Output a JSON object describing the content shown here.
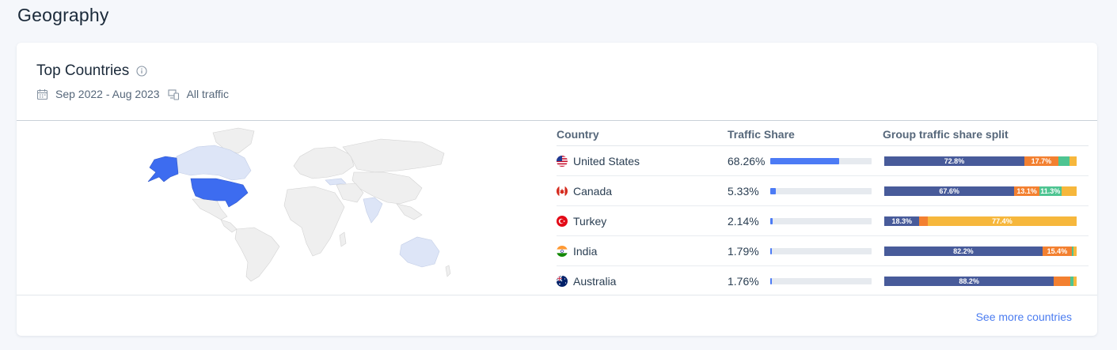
{
  "page": {
    "title": "Geography"
  },
  "card": {
    "title": "Top Countries",
    "date_range": "Sep 2022 - Aug 2023",
    "traffic_filter": "All traffic",
    "see_more_label": "See more countries"
  },
  "table": {
    "headers": {
      "country": "Country",
      "share": "Traffic Share",
      "split": "Group traffic share split"
    },
    "rows": [
      {
        "country": "United States",
        "flag": "us-flag-icon",
        "share": "68.26%",
        "share_value": 68.26,
        "split": [
          {
            "value": 72.8,
            "label": "72.8%",
            "color": "#485b9a"
          },
          {
            "value": 17.7,
            "label": "17.7%",
            "color": "#f38030"
          },
          {
            "value": 6.0,
            "label": "",
            "color": "#4ec491"
          },
          {
            "value": 3.5,
            "label": "",
            "color": "#f6b73c"
          }
        ]
      },
      {
        "country": "Canada",
        "flag": "ca-flag-icon",
        "share": "5.33%",
        "share_value": 5.33,
        "split": [
          {
            "value": 67.6,
            "label": "67.6%",
            "color": "#485b9a"
          },
          {
            "value": 13.1,
            "label": "13.1%",
            "color": "#f38030"
          },
          {
            "value": 11.3,
            "label": "11.3%",
            "color": "#4ec491"
          },
          {
            "value": 8.0,
            "label": "",
            "color": "#f6b73c"
          }
        ]
      },
      {
        "country": "Turkey",
        "flag": "tr-flag-icon",
        "share": "2.14%",
        "share_value": 2.14,
        "split": [
          {
            "value": 18.3,
            "label": "18.3%",
            "color": "#485b9a"
          },
          {
            "value": 4.3,
            "label": "",
            "color": "#f38030"
          },
          {
            "value": 77.4,
            "label": "77.4%",
            "color": "#f6b73c"
          }
        ]
      },
      {
        "country": "India",
        "flag": "in-flag-icon",
        "share": "1.79%",
        "share_value": 1.79,
        "split": [
          {
            "value": 82.2,
            "label": "82.2%",
            "color": "#485b9a"
          },
          {
            "value": 15.4,
            "label": "15.4%",
            "color": "#f38030"
          },
          {
            "value": 0.6,
            "label": "",
            "color": "#4ec491"
          },
          {
            "value": 1.8,
            "label": "",
            "color": "#f6b73c"
          }
        ]
      },
      {
        "country": "Australia",
        "flag": "au-flag-icon",
        "share": "1.76%",
        "share_value": 1.76,
        "split": [
          {
            "value": 88.2,
            "label": "88.2%",
            "color": "#485b9a"
          },
          {
            "value": 8.7,
            "label": "",
            "color": "#f38030"
          },
          {
            "value": 1.3,
            "label": "",
            "color": "#4ec491"
          },
          {
            "value": 1.8,
            "label": "",
            "color": "#f6b73c"
          }
        ]
      }
    ]
  },
  "colors": {
    "share_bar": "#4c7bf5",
    "map_highlight": "#3d6cf0",
    "map_light": "#dde5f7",
    "map_base": "#f0f0f0",
    "link": "#4b7cf0"
  }
}
